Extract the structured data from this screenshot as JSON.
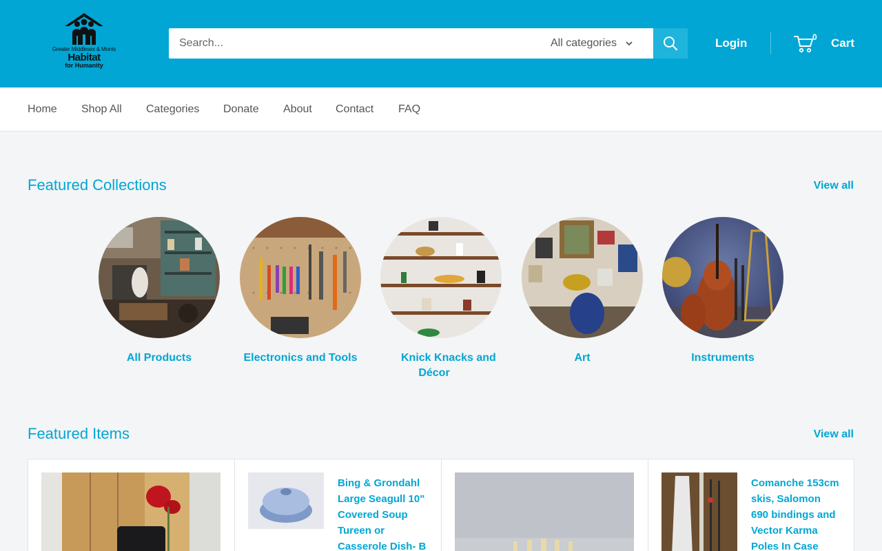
{
  "header": {
    "logo": {
      "line1": "Greater Middlesex & Morris",
      "line2": "Habitat",
      "line3": "for Humanity"
    },
    "search": {
      "placeholder": "Search...",
      "category": "All categories"
    },
    "login_label": "Login",
    "cart_count": "0",
    "cart_label": "Cart",
    "colors": {
      "brand": "#01a6d4",
      "search_button": "#1fb4dc"
    }
  },
  "nav": {
    "items": [
      "Home",
      "Shop All",
      "Categories",
      "Donate",
      "About",
      "Contact",
      "FAQ"
    ]
  },
  "featured_collections": {
    "title": "Featured Collections",
    "view_all": "View all",
    "collections": [
      {
        "label": "All Products"
      },
      {
        "label": "Electronics and Tools"
      },
      {
        "label_line1": "Knick Knacks and",
        "label_line2": "Décor"
      },
      {
        "label": "Art"
      },
      {
        "label": "Instruments"
      }
    ]
  },
  "featured_items": {
    "title": "Featured Items",
    "view_all": "View all",
    "items": [
      {
        "title_lines": []
      },
      {
        "title_lines": [
          "Bing & Grondahl",
          "Large Seagull 10\"",
          "Covered Soup",
          "Tureen or",
          "Casserole Dish- B"
        ]
      },
      {
        "title_lines": []
      },
      {
        "title_lines": [
          "Comanche 153cm",
          "skis, Salomon",
          "690 bindings and",
          "Vector Karma",
          "Poles In Case"
        ]
      }
    ]
  }
}
